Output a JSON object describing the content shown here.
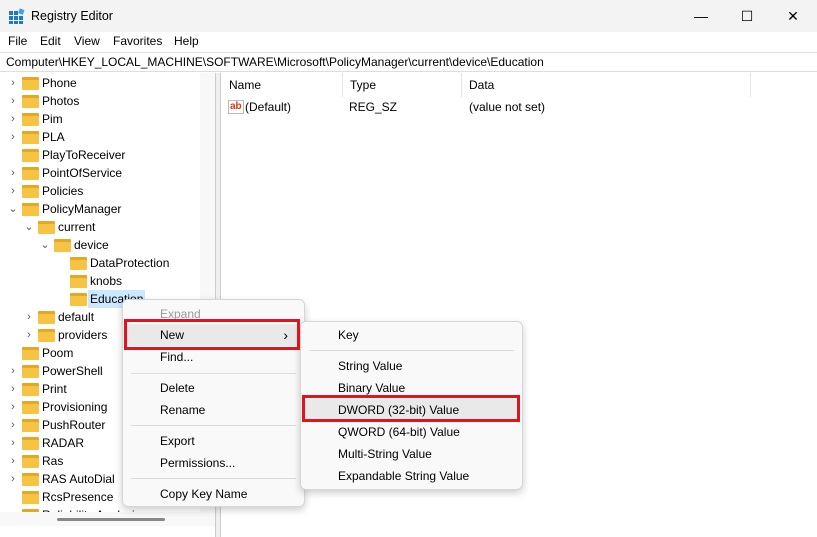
{
  "window": {
    "title": "Registry Editor",
    "minimize": "—",
    "maximize": "☐",
    "close": "✕"
  },
  "menubar": [
    "File",
    "Edit",
    "View",
    "Favorites",
    "Help"
  ],
  "address": "Computer\\HKEY_LOCAL_MACHINE\\SOFTWARE\\Microsoft\\PolicyManager\\current\\device\\Education",
  "tree": [
    {
      "label": "Phone",
      "level": 0,
      "exp": "›"
    },
    {
      "label": "Photos",
      "level": 0,
      "exp": "›"
    },
    {
      "label": "Pim",
      "level": 0,
      "exp": "›"
    },
    {
      "label": "PLA",
      "level": 0,
      "exp": "›"
    },
    {
      "label": "PlayToReceiver",
      "level": 0,
      "exp": ""
    },
    {
      "label": "PointOfService",
      "level": 0,
      "exp": "›"
    },
    {
      "label": "Policies",
      "level": 0,
      "exp": "›"
    },
    {
      "label": "PolicyManager",
      "level": 0,
      "exp": "⌄"
    },
    {
      "label": "current",
      "level": 1,
      "exp": "⌄"
    },
    {
      "label": "device",
      "level": 2,
      "exp": "⌄"
    },
    {
      "label": "DataProtection",
      "level": 3,
      "exp": ""
    },
    {
      "label": "knobs",
      "level": 3,
      "exp": ""
    },
    {
      "label": "Education",
      "level": 3,
      "exp": "",
      "selected": true
    },
    {
      "label": "default",
      "level": 1,
      "exp": "›"
    },
    {
      "label": "providers",
      "level": 1,
      "exp": "›"
    },
    {
      "label": "Poom",
      "level": 0,
      "exp": ""
    },
    {
      "label": "PowerShell",
      "level": 0,
      "exp": "›"
    },
    {
      "label": "Print",
      "level": 0,
      "exp": "›"
    },
    {
      "label": "Provisioning",
      "level": 0,
      "exp": "›"
    },
    {
      "label": "PushRouter",
      "level": 0,
      "exp": "›"
    },
    {
      "label": "RADAR",
      "level": 0,
      "exp": "›"
    },
    {
      "label": "Ras",
      "level": 0,
      "exp": "›"
    },
    {
      "label": "RAS AutoDial",
      "level": 0,
      "exp": "›"
    },
    {
      "label": "RcsPresence",
      "level": 0,
      "exp": ""
    },
    {
      "label": "Reliability Analysis",
      "level": 0,
      "exp": "›"
    }
  ],
  "columns": {
    "name": "Name",
    "type": "Type",
    "data": "Data"
  },
  "values": [
    {
      "icon": "ab",
      "name": "(Default)",
      "type": "REG_SZ",
      "data": "(value not set)"
    }
  ],
  "context_menu": {
    "expand": "Expand",
    "new": "New",
    "new_arrow": "›",
    "find": "Find...",
    "delete": "Delete",
    "rename": "Rename",
    "export": "Export",
    "permissions": "Permissions...",
    "copy_key_name": "Copy Key Name"
  },
  "submenu": {
    "key": "Key",
    "string": "String Value",
    "binary": "Binary Value",
    "dword": "DWORD (32-bit) Value",
    "qword": "QWORD (64-bit) Value",
    "multi": "Multi-String Value",
    "expandable": "Expandable String Value"
  },
  "colors": {
    "highlight_box": "#e0141e",
    "selection": "#cce8ff",
    "folder": "#f6c343"
  }
}
